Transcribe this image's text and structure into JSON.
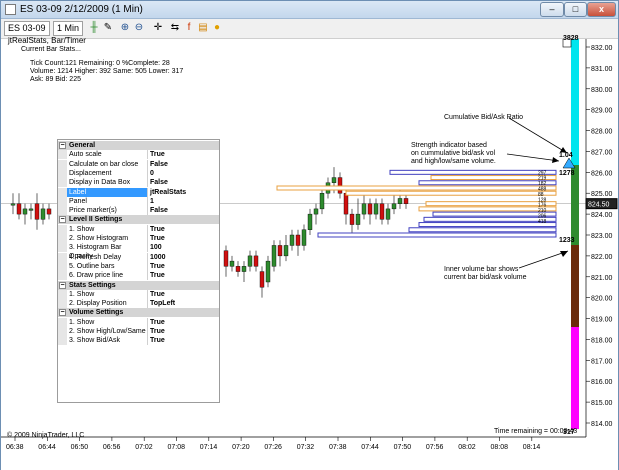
{
  "window": {
    "title": "ES 03-09  2/12/2009 (1 Min)",
    "min_label": "–",
    "max_label": "□",
    "close_label": "x"
  },
  "toolbar": {
    "instrument": "ES 03-09",
    "interval": "1 Min"
  },
  "chart": {
    "indicator_label": "jtRealStats, Bar/Timer",
    "stats_header": "Current Bar Stats...",
    "stats_line1": "Tick Count:121  Remaining: 0  %Complete: 28",
    "stats_line2": "Volume: 1214  Higher: 392  Same: 505  Lower: 317",
    "stats_line3": "Ask: 89  Bid: 225",
    "copyright": "© 2009 NinjaTrader, LLC",
    "time_remaining": "Time remaining = 00:00:43",
    "annotation1": "Cumulative Bid/Ask Ratio",
    "annotation2_l1": "Strength indicator based",
    "annotation2_l2": "on cummulative bid/ask vol",
    "annotation2_l3": "and high/low/same volume.",
    "annotation3_l1": "Inner volume bar shows",
    "annotation3_l2": "current bar bid/ask volume",
    "ratio_value": "1.04",
    "strength_value": "1278",
    "volume_value": "1233",
    "top_value": "3828",
    "bottom_value": "317",
    "current_price": "824.50",
    "hist_values": [
      "297",
      "219",
      "182",
      "488",
      "88",
      "128",
      "176",
      "210",
      "206",
      "418"
    ],
    "price_ticks": [
      "832.00",
      "831.00",
      "830.00",
      "829.00",
      "828.00",
      "827.00",
      "826.00",
      "825.00",
      "824.00",
      "823.00",
      "822.00",
      "821.00",
      "820.00",
      "819.00",
      "818.00",
      "817.00",
      "816.00",
      "815.00",
      "814.00"
    ],
    "time_ticks": [
      "06:38",
      "06:44",
      "06:50",
      "06:56",
      "07:02",
      "07:08",
      "07:14",
      "07:20",
      "07:26",
      "07:32",
      "07:38",
      "07:44",
      "07:50",
      "07:56",
      "08:02",
      "08:08",
      "08:14"
    ],
    "colors": {
      "up_candle": "#2e8b2e",
      "down_candle": "#d01010",
      "hist_bar_fill": "#ffffff",
      "hist_border_top": "#3030a0",
      "hist_orange": "#e8a040",
      "hist_blue": "#4040c0",
      "vol_cyan": "#00e5ee",
      "vol_green": "#2e8b2e",
      "vol_brown": "#6b2a0a",
      "vol_magenta": "#ff00ff"
    }
  },
  "properties": {
    "rows": [
      {
        "type": "cat",
        "label": "General"
      },
      {
        "type": "row",
        "label": "Auto scale",
        "value": "True"
      },
      {
        "type": "row",
        "label": "Calculate on bar close",
        "value": "False"
      },
      {
        "type": "row",
        "label": "Displacement",
        "value": "0"
      },
      {
        "type": "row",
        "label": "Display in Data Box",
        "value": "False"
      },
      {
        "type": "sel",
        "label": "Label",
        "value": "jtRealStats"
      },
      {
        "type": "row",
        "label": "Panel",
        "value": "1"
      },
      {
        "type": "row",
        "label": "Price marker(s)",
        "value": "False"
      },
      {
        "type": "cat",
        "label": "Level II Settings"
      },
      {
        "type": "row",
        "label": "1. Show",
        "value": "True"
      },
      {
        "type": "row",
        "label": "2. Show Histogram",
        "value": "True"
      },
      {
        "type": "row",
        "label": "3. Histogram Bar Opacity",
        "value": "100"
      },
      {
        "type": "row",
        "label": "4. Refresh Delay",
        "value": "1000"
      },
      {
        "type": "row",
        "label": "5. Outline bars",
        "value": "True"
      },
      {
        "type": "row",
        "label": "6. Draw price line",
        "value": "True"
      },
      {
        "type": "cat",
        "label": "Stats Settings"
      },
      {
        "type": "row",
        "label": "1. Show",
        "value": "True"
      },
      {
        "type": "row",
        "label": "2. Display Position",
        "value": "TopLeft"
      },
      {
        "type": "cat",
        "label": "Volume Settings"
      },
      {
        "type": "row",
        "label": "1. Show",
        "value": "True"
      },
      {
        "type": "row",
        "label": "2. Show High/Low/Same",
        "value": "True"
      },
      {
        "type": "row",
        "label": "3. Show Bid/Ask",
        "value": "True"
      }
    ]
  }
}
